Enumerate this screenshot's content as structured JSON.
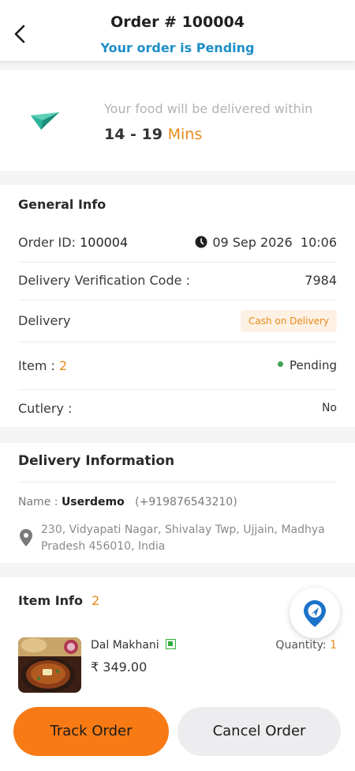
{
  "header": {
    "title": "Order # 100004",
    "status": "Your order is Pending"
  },
  "eta": {
    "label": "Your food will be delivered within",
    "range": "14 - 19",
    "unit": "Mins"
  },
  "general_info": {
    "title": "General Info",
    "order_id_label": "Order ID:",
    "order_id": "100004",
    "date": "09 Sep 2026",
    "time": "10:06",
    "verification_label": "Delivery Verification Code :",
    "verification_code": "7984",
    "delivery_label": "Delivery",
    "payment_method": "Cash on Delivery",
    "item_label": "Item :",
    "item_count": "2",
    "order_status": "Pending",
    "cutlery_label": "Cutlery :",
    "cutlery_value": "No"
  },
  "delivery_info": {
    "title": "Delivery Information",
    "name_label": "Name :",
    "name": "Userdemo",
    "phone": "(+919876543210)",
    "address": "230, Vidyapati Nagar, Shivalay Twp, Ujjain, Madhya Pradesh 456010, India"
  },
  "item_info": {
    "title": "Item Info",
    "count": "2",
    "items": [
      {
        "name": "Dal Makhani",
        "price": "₹ 349.00",
        "quantity_label": "Quantity:",
        "quantity": "1",
        "veg": true
      }
    ]
  },
  "actions": {
    "track": "Track Order",
    "cancel": "Cancel Order"
  },
  "colors": {
    "accent_orange": "#f77a14",
    "status_blue": "#1e8fc9",
    "pending_green": "#3fa34d",
    "map_blue": "#1a73c9"
  },
  "icons": [
    "back-arrow-icon",
    "paper-plane-icon",
    "clock-icon",
    "location-pin-icon",
    "veg-indicator-icon",
    "map-navigation-icon"
  ]
}
